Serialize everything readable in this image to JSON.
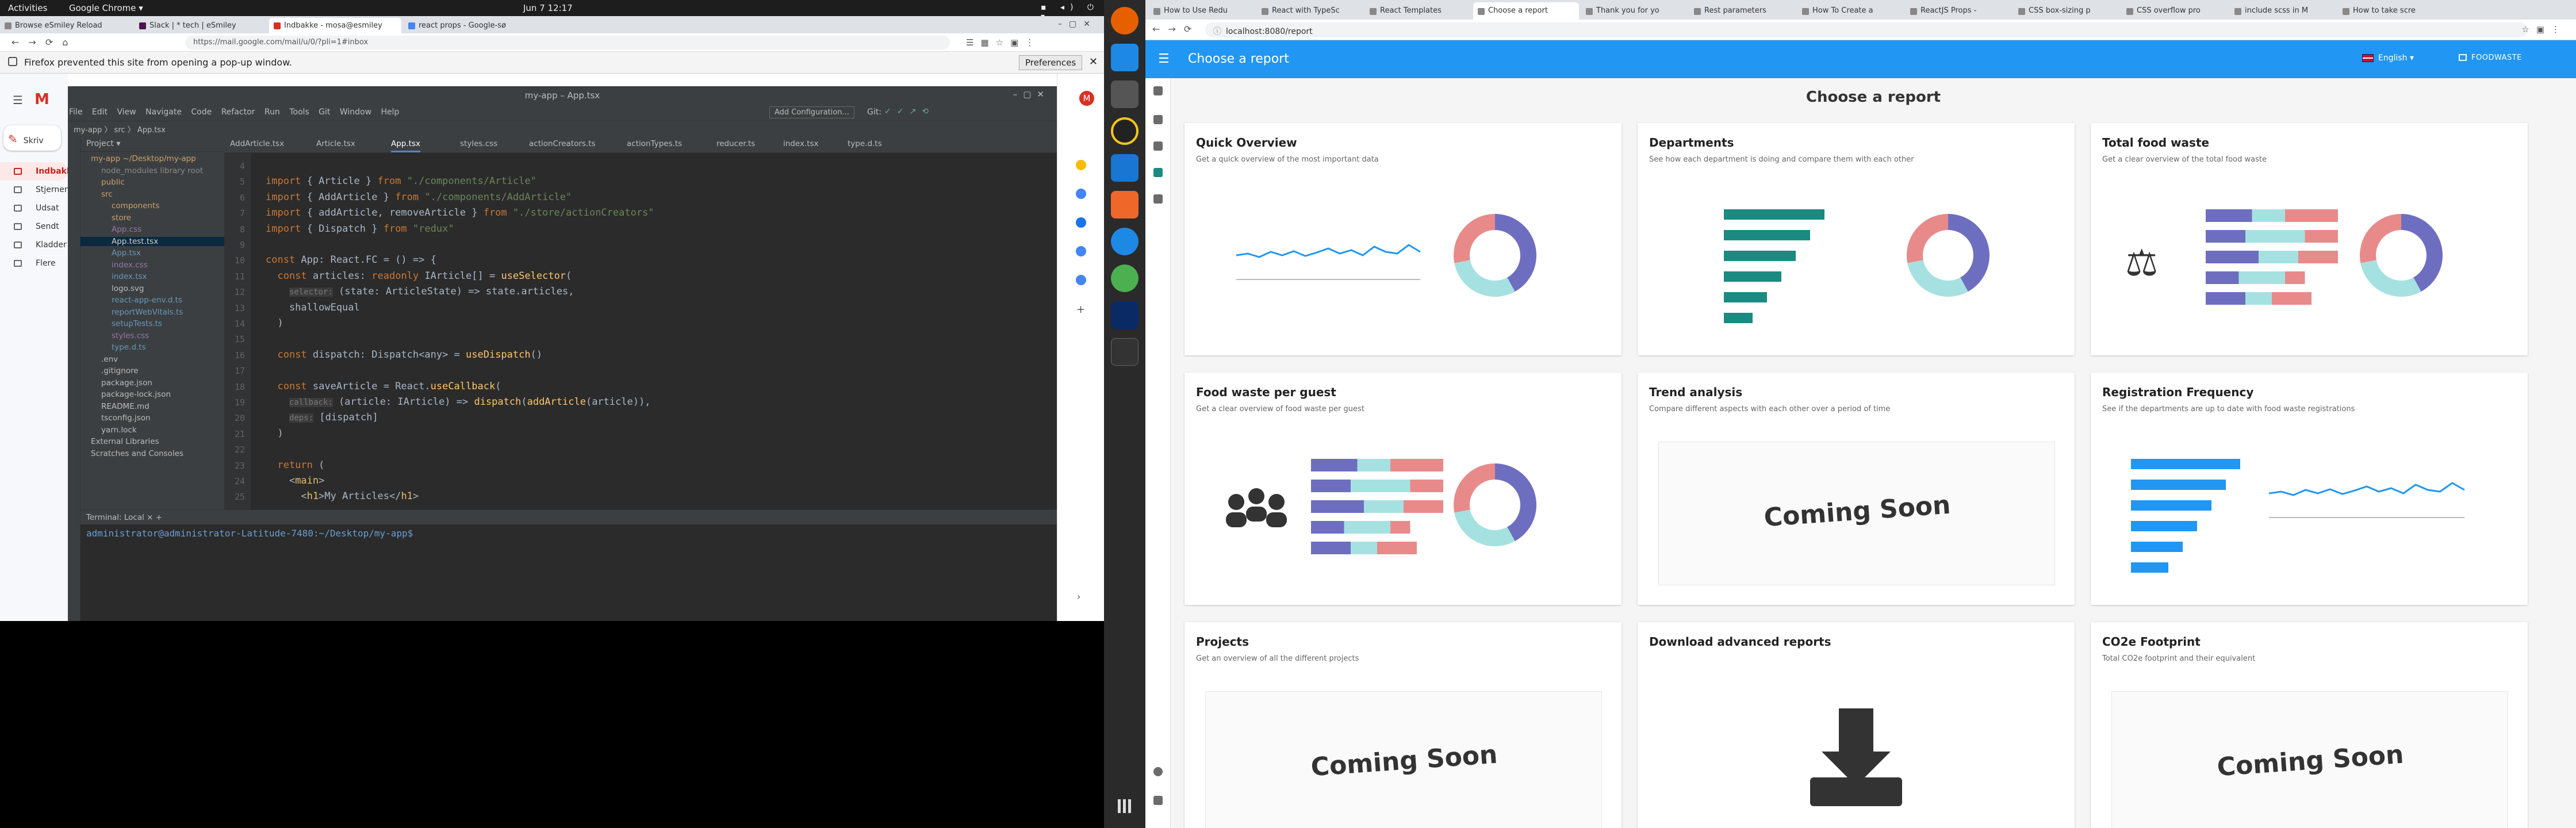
{
  "gnome": {
    "activities": "Activities",
    "app": "Google Chrome ▾",
    "clock": "Jun 7  12:17"
  },
  "left_browser": {
    "tabs": [
      "Browse eSmiley Reload",
      "Slack | * tech | eSmiley",
      "Indbakke - mosa@esmiley",
      "react props - Google-sø"
    ],
    "url": "https://mail.google.com/mail/u/0/?pli=1#inbox",
    "popup_message": "Firefox prevented this site from opening a pop-up window.",
    "preferences": "Preferences"
  },
  "gmail": {
    "compose": "Skriv",
    "items": [
      "Indbakke",
      "Stjernem",
      "Udsat",
      "Sendt",
      "Kladder",
      "Flere"
    ]
  },
  "ide": {
    "title": "my-app – App.tsx",
    "menu": [
      "File",
      "Edit",
      "View",
      "Navigate",
      "Code",
      "Refactor",
      "Run",
      "Tools",
      "Git",
      "Window",
      "Help"
    ],
    "add_config": "Add Configuration...",
    "git_label": "Git:",
    "breadcrumb": "my-app  〉 src 〉 App.tsx",
    "project_label": "Project ▾",
    "tree": [
      {
        "label": "my-app  ~/Desktop/my-app",
        "cls": "fold",
        "indent": 0
      },
      {
        "label": "node_modules  library root",
        "cls": "lib",
        "indent": 1
      },
      {
        "label": "public",
        "cls": "fold",
        "indent": 1
      },
      {
        "label": "src",
        "cls": "fold",
        "indent": 1
      },
      {
        "label": "components",
        "cls": "fold",
        "indent": 2
      },
      {
        "label": "store",
        "cls": "fold",
        "indent": 2
      },
      {
        "label": "App.css",
        "cls": "css",
        "indent": 2
      },
      {
        "label": "App.test.tsx",
        "cls": "ts selrow",
        "indent": 2
      },
      {
        "label": "App.tsx",
        "cls": "ts",
        "indent": 2
      },
      {
        "label": "index.css",
        "cls": "css",
        "indent": 2
      },
      {
        "label": "index.tsx",
        "cls": "ts",
        "indent": 2
      },
      {
        "label": "logo.svg",
        "cls": "",
        "indent": 2
      },
      {
        "label": "react-app-env.d.ts",
        "cls": "ts",
        "indent": 2
      },
      {
        "label": "reportWebVitals.ts",
        "cls": "ts",
        "indent": 2
      },
      {
        "label": "setupTests.ts",
        "cls": "ts",
        "indent": 2
      },
      {
        "label": "styles.css",
        "cls": "css",
        "indent": 2
      },
      {
        "label": "type.d.ts",
        "cls": "ts",
        "indent": 2
      },
      {
        "label": ".env",
        "cls": "",
        "indent": 1
      },
      {
        "label": ".gitignore",
        "cls": "",
        "indent": 1
      },
      {
        "label": "package.json",
        "cls": "",
        "indent": 1
      },
      {
        "label": "package-lock.json",
        "cls": "",
        "indent": 1
      },
      {
        "label": "README.md",
        "cls": "",
        "indent": 1
      },
      {
        "label": "tsconfig.json",
        "cls": "",
        "indent": 1
      },
      {
        "label": "yarn.lock",
        "cls": "",
        "indent": 1
      },
      {
        "label": "External Libraries",
        "cls": "",
        "indent": 0
      },
      {
        "label": "Scratches and Consoles",
        "cls": "",
        "indent": 0
      }
    ],
    "editor_tabs": [
      "AddArticle.tsx",
      "Article.tsx",
      "App.tsx",
      "styles.css",
      "actionCreators.ts",
      "actionTypes.ts",
      "reducer.ts",
      "index.tsx",
      "type.d.ts"
    ],
    "active_tab": "App.tsx",
    "lines": [
      {
        "n": "4",
        "html": ""
      },
      {
        "n": "5",
        "html": "<span class='k'>import</span> { Article } <span class='k'>from</span> <span class='s'>\"./components/Article\"</span>"
      },
      {
        "n": "6",
        "html": "<span class='k'>import</span> { AddArticle } <span class='k'>from</span> <span class='s'>\"./components/AddArticle\"</span>"
      },
      {
        "n": "7",
        "html": "<span class='k'>import</span> { addArticle, removeArticle } <span class='k'>from</span> <span class='s'>\"./store/actionCreators\"</span>"
      },
      {
        "n": "8",
        "html": "<span class='k'>import</span> { Dispatch } <span class='k'>from</span> <span class='s'>\"redux\"</span>"
      },
      {
        "n": "9",
        "html": ""
      },
      {
        "n": "10",
        "html": "<span class='k'>const</span> App: React.FC = () => {"
      },
      {
        "n": "11",
        "html": "  <span class='k'>const</span> articles: <span class='k'>readonly</span> IArticle[] = <span class='f'>useSelector</span>("
      },
      {
        "n": "12",
        "html": "    <span class='h'>selector:</span> (state: ArticleState) => state.articles,"
      },
      {
        "n": "13",
        "html": "    shallowEqual"
      },
      {
        "n": "14",
        "html": "  )"
      },
      {
        "n": "15",
        "html": ""
      },
      {
        "n": "16",
        "html": "  <span class='k'>const</span> dispatch: Dispatch&lt;any&gt; = <span class='f'>useDispatch</span>()"
      },
      {
        "n": "17",
        "html": ""
      },
      {
        "n": "18",
        "html": "  <span class='k'>const</span> saveArticle = React.<span class='f'>useCallback</span>("
      },
      {
        "n": "19",
        "html": "    <span class='h'>callback:</span> (article: IArticle) => <span class='f'>dispatch</span>(<span class='f'>addArticle</span>(article)),"
      },
      {
        "n": "20",
        "html": "    <span class='h'>deps:</span> [dispatch]"
      },
      {
        "n": "21",
        "html": "  )"
      },
      {
        "n": "22",
        "html": ""
      },
      {
        "n": "23",
        "html": "  <span class='k'>return</span> ("
      },
      {
        "n": "24",
        "html": "    &lt;<span class='tg'>main</span>&gt;"
      },
      {
        "n": "25",
        "html": "      &lt;<span class='tg'>h1</span>&gt;My Articles&lt;/<span class='tg'>h1</span>&gt;"
      }
    ],
    "terminal_tabs": "Terminal:   Local  ×   +",
    "terminal_line": "administrator@administrator-Latitude-7480:~/Desktop/my-app$ "
  },
  "right_browser": {
    "tabs": [
      "How to Use Redu",
      "React with TypeSc",
      "React Templates",
      "Choose a report",
      "Thank you for yo",
      "Rest parameters",
      "How To Create a",
      "ReactJS Props -",
      "CSS box-sizing p",
      "CSS overflow pro",
      "include scss in M",
      "How to take scre"
    ],
    "active_tab": 3,
    "url": "localhost:8080/report"
  },
  "app": {
    "title": "Choose a report",
    "language": "English  ▾",
    "brand": "FOODWASTE",
    "heading": "Choose a report",
    "coming_soon": "Coming Soon",
    "cards": [
      {
        "title": "Quick Overview",
        "subtitle": "Get a quick overview of the most important data",
        "kind": "line-donut"
      },
      {
        "title": "Departments",
        "subtitle": "See how each department is doing and compare them with each other",
        "kind": "bars-donut"
      },
      {
        "title": "Total food waste",
        "subtitle": "Get a clear overview of the total food waste",
        "kind": "scale-stack-donut"
      },
      {
        "title": "Food waste per guest",
        "subtitle": "Get a clear overview of food waste per guest",
        "kind": "people-stack-donut"
      },
      {
        "title": "Trend analysis",
        "subtitle": "Compare different aspects with each other over a period of time",
        "kind": "coming"
      },
      {
        "title": "Registration Frequency",
        "subtitle": "See if the departments are up to date with food waste registrations",
        "kind": "bars-line"
      },
      {
        "title": "Projects",
        "subtitle": "Get an overview of all the different projects",
        "kind": "coming"
      },
      {
        "title": "Download advanced reports",
        "subtitle": "",
        "kind": "download"
      },
      {
        "title": "CO2e Footprint",
        "subtitle": "Total CO2e footprint and their equivalent",
        "kind": "coming"
      }
    ]
  },
  "colors": {
    "primary": "#2196f3",
    "teal": "#1b8a80",
    "purple": "#6e6ec0",
    "pink": "#e88a8a",
    "cyan": "#a6e1e1",
    "grey": "#c8c8c8"
  }
}
